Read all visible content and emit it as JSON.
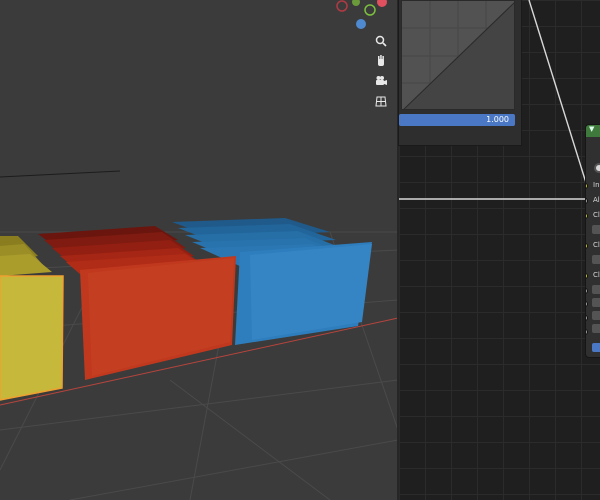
{
  "viewport": {
    "navigation_icons": [
      "zoom-icon",
      "hand-pan-icon",
      "camera-icon",
      "grid-view-icon"
    ],
    "gizmo_axis_colors": {
      "x": "#e0505e",
      "y": "#7bbf3f",
      "z": "#4f8ad1"
    },
    "object_colors": {
      "yellow": "#c6b83a",
      "red": "#c0391e",
      "blue": "#2d7cbf"
    }
  },
  "curve_panel": {
    "value": "1.000",
    "accent": "#4a78c4"
  },
  "node": {
    "header_color": "#3f7a3c",
    "sockets": [
      {
        "label": "In",
        "type": "yellow"
      },
      {
        "label": "Al",
        "type": "gray"
      },
      {
        "label": "Cl",
        "type": "yellow"
      },
      {
        "label": "Cl",
        "type": "yellow"
      },
      {
        "label": "Cl",
        "type": "yellow"
      }
    ]
  }
}
